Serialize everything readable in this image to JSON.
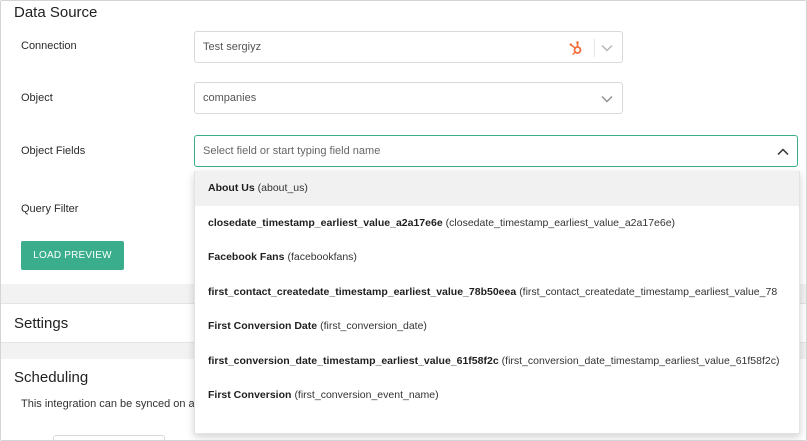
{
  "data_source": {
    "title": "Data Source"
  },
  "connection": {
    "label": "Connection",
    "value": "Test sergiyz",
    "icon": "hubspot-icon",
    "icon_color": "#f26c39"
  },
  "object": {
    "label": "Object",
    "value": "companies"
  },
  "object_fields": {
    "label": "Object Fields",
    "placeholder": "Select field or start typing field name",
    "options": [
      {
        "name": "About Us",
        "key": "(about_us)"
      },
      {
        "name": "closedate_timestamp_earliest_value_a2a17e6e",
        "key": "(closedate_timestamp_earliest_value_a2a17e6e)"
      },
      {
        "name": "Facebook Fans",
        "key": "(facebookfans)"
      },
      {
        "name": "first_contact_createdate_timestamp_earliest_value_78b50eea",
        "key": "(first_contact_createdate_timestamp_earliest_value_78"
      },
      {
        "name": "First Conversion Date",
        "key": "(first_conversion_date)"
      },
      {
        "name": "first_conversion_date_timestamp_earliest_value_61f58f2c",
        "key": "(first_conversion_date_timestamp_earliest_value_61f58f2c)"
      },
      {
        "name": "First Conversion",
        "key": "(first_conversion_event_name)"
      }
    ]
  },
  "query_filter": {
    "label": "Query Filter"
  },
  "load_preview": {
    "label": "LOAD PREVIEW"
  },
  "settings": {
    "title": "Settings"
  },
  "scheduling": {
    "title": "Scheduling",
    "note": "This integration can be synced on a"
  },
  "colors": {
    "accent": "#3aae8c",
    "band": "#f2f2f2"
  }
}
